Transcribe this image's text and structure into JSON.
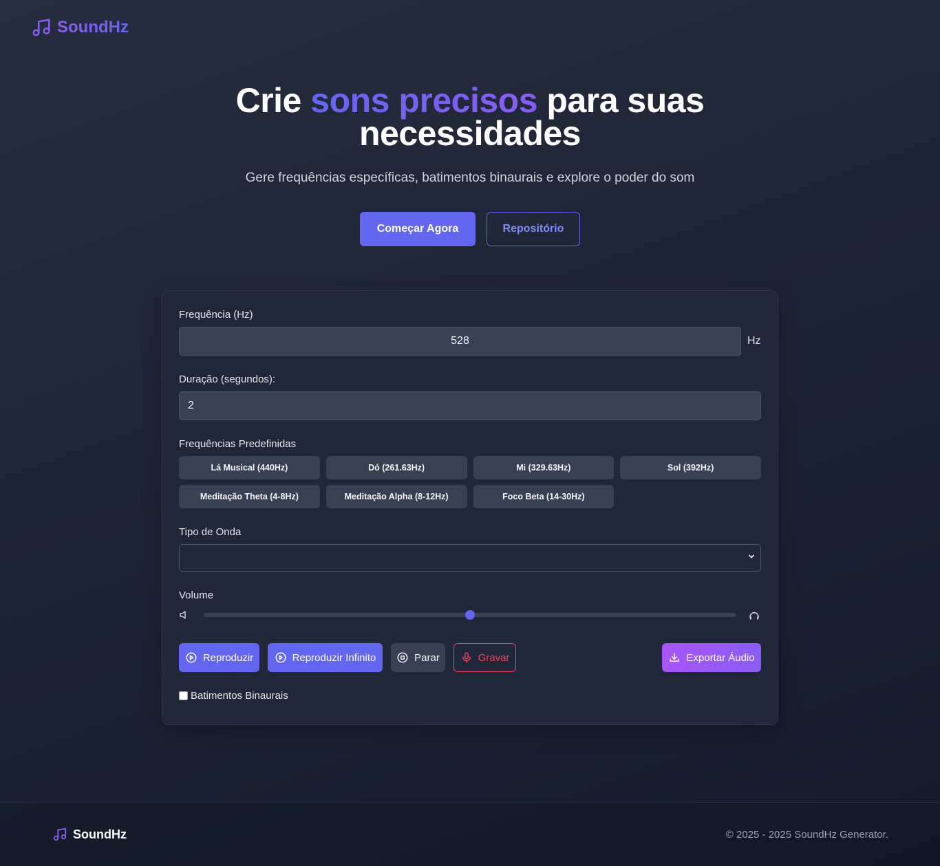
{
  "header": {
    "brand_name": "SoundHz",
    "logo_icon": "music-note-icon",
    "brand_color": "#8b5cf6"
  },
  "hero": {
    "title_part1": "Crie ",
    "title_accent": "sons precisos",
    "title_part2": " para suas",
    "title_line2": "necessidades",
    "subtitle": "Gere frequências específicas, batimentos binaurais e explore o poder do som",
    "primary_button": "Começar Agora",
    "secondary_button": "Repositório"
  },
  "generator": {
    "frequency_label": "Frequência (Hz)",
    "frequency_value": "528",
    "frequency_unit": "Hz",
    "duration_label": "Duração (segundos):",
    "duration_value": "2",
    "presets_label": "Frequências Predefinidas",
    "presets": [
      "Lá Musical (440Hz)",
      "Dó (261.63Hz)",
      "Mi (329.63Hz)",
      "Sol (392Hz)",
      "Meditação Theta (4-8Hz)",
      "Meditação Alpha (8-12Hz)",
      "Foco Beta (14-30Hz)"
    ],
    "wave_label": "Tipo de Onda",
    "wave_selected": "",
    "volume_label": "Volume",
    "volume_level": 0.5,
    "buttons": {
      "play": "Reproduzir",
      "loop": "Reproduzir Infinito",
      "stop": "Parar",
      "record": "Gravar",
      "export": "Exportar Áudio"
    },
    "binaural_label": "Batimentos Binaurais",
    "binaural_checked": false
  },
  "footer": {
    "brand_name": "SoundHz",
    "copyright": "© 2025 - 2025 SoundHz Generator."
  },
  "colors": {
    "accent": "#6366f1",
    "accent_purple": "#8b5cf6",
    "record_red": "#f43f5e",
    "background": "#1c2333",
    "card": "#1f2738"
  }
}
